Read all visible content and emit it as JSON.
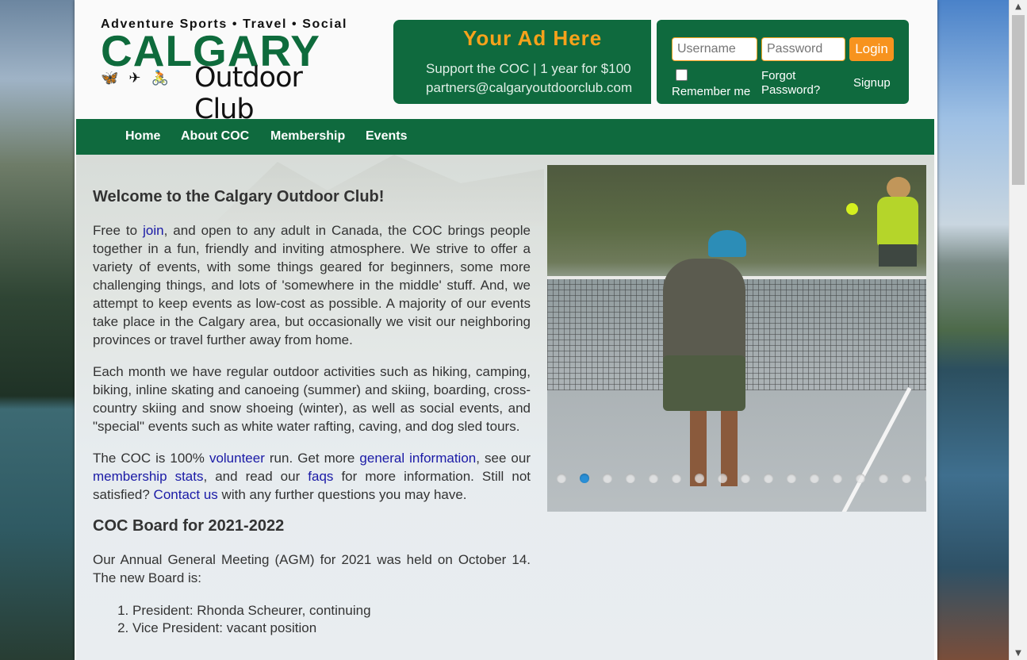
{
  "header": {
    "logo_tagline": "Adventure Sports • Travel • Social",
    "logo_main": "CALGARY",
    "logo_sub": "Outdoor Club",
    "logo_icons": "🦋 ✈ 🚴"
  },
  "ad": {
    "title": "Your Ad Here",
    "line1": "Support the COC  |  1 year for $100",
    "line2": "partners@calgaryoutdoorclub.com"
  },
  "login": {
    "username_placeholder": "Username",
    "password_placeholder": "Password",
    "login_label": "Login",
    "remember_label": "Remember me",
    "forgot_label": "Forgot Password?",
    "signup_label": "Signup"
  },
  "nav": {
    "items": [
      {
        "label": "Home"
      },
      {
        "label": "About COC"
      },
      {
        "label": "Membership"
      },
      {
        "label": "Events"
      }
    ]
  },
  "main": {
    "welcome_heading": "Welcome to the Calgary Outdoor Club!",
    "p1": {
      "pre": "Free to ",
      "link_join": "join",
      "post": ", and open to any adult in Canada, the COC brings people together in a fun, friendly and inviting atmosphere. We strive to offer a variety of events, with some things geared for beginners, some more challenging things, and lots of 'somewhere in the middle' stuff. And, we attempt to keep events as low-cost as possible. A majority of our events take place in the Calgary area, but occasionally we visit our neighboring provinces or travel further away from home."
    },
    "p2": "Each month we have regular outdoor activities such as hiking, camping, biking, inline skating and canoeing (summer) and skiing, boarding, cross-country skiing and snow shoeing (winter), as well as social events, and \"special\" events such as white water rafting, caving, and dog sled tours.",
    "p3": {
      "t1": "The COC is 100% ",
      "link_volunteer": "volunteer",
      "t2": " run. Get more ",
      "link_general": "general information",
      "t3": ", see our ",
      "link_stats": "membership stats",
      "t4": ", and read our ",
      "link_faqs": "faqs",
      "t5": " for more information. Still not satisfied? ",
      "link_contact": "Contact us",
      "t6": " with any further questions you may have."
    },
    "board_heading": "COC Board for 2021-2022",
    "p4": "Our Annual General Meeting (AGM) for 2021 was held on October 14. The new Board is:",
    "board_list": [
      "President: Rhonda Scheurer, continuing",
      "Vice President: vacant position"
    ]
  },
  "slider": {
    "dot_count": 17,
    "active_index": 1
  },
  "colors": {
    "brand_green": "#0f6a3e",
    "accent_orange": "#f7931e",
    "link_blue": "#1a1aa6"
  }
}
